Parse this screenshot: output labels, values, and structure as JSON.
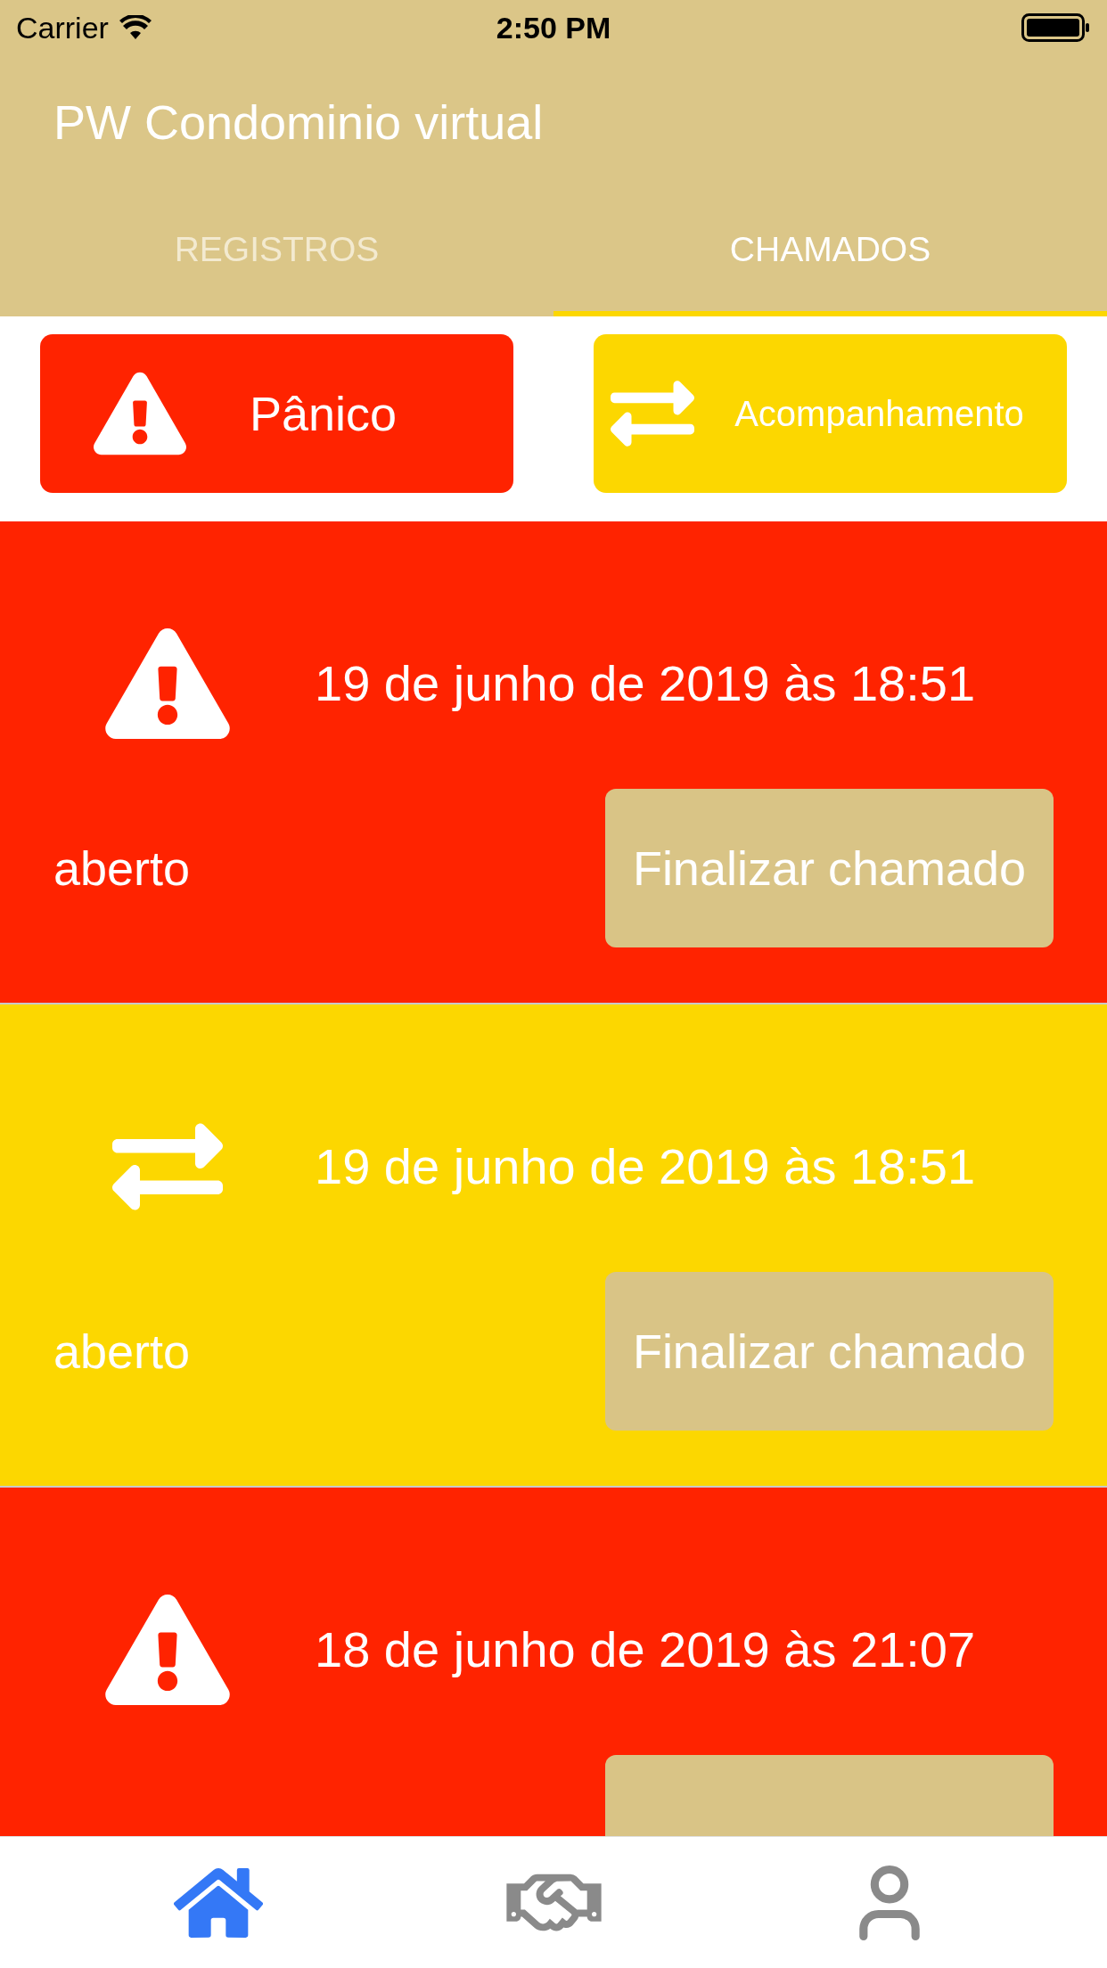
{
  "status_bar": {
    "carrier": "Carrier",
    "time": "2:50 PM"
  },
  "header": {
    "title": "PW Condominio virtual"
  },
  "tabs": [
    {
      "label": "REGISTROS",
      "selected": false
    },
    {
      "label": "CHAMADOS",
      "selected": true
    }
  ],
  "actions": [
    {
      "kind": "panic",
      "label": "Pânico"
    },
    {
      "kind": "tracking",
      "label": "Acompanhamento"
    }
  ],
  "calls": [
    {
      "kind": "panic",
      "datetime": "19 de junho de 2019 às 18:51",
      "status": "aberto",
      "button": "Finalizar chamado"
    },
    {
      "kind": "tracking",
      "datetime": "19 de junho de 2019 às 18:51",
      "status": "aberto",
      "button": "Finalizar chamado"
    },
    {
      "kind": "panic",
      "datetime": "18 de junho de 2019 às 21:07"
    }
  ],
  "bottom_nav": [
    {
      "kind": "home",
      "selected": true
    },
    {
      "kind": "deals",
      "selected": false
    },
    {
      "kind": "profile",
      "selected": false
    }
  ]
}
